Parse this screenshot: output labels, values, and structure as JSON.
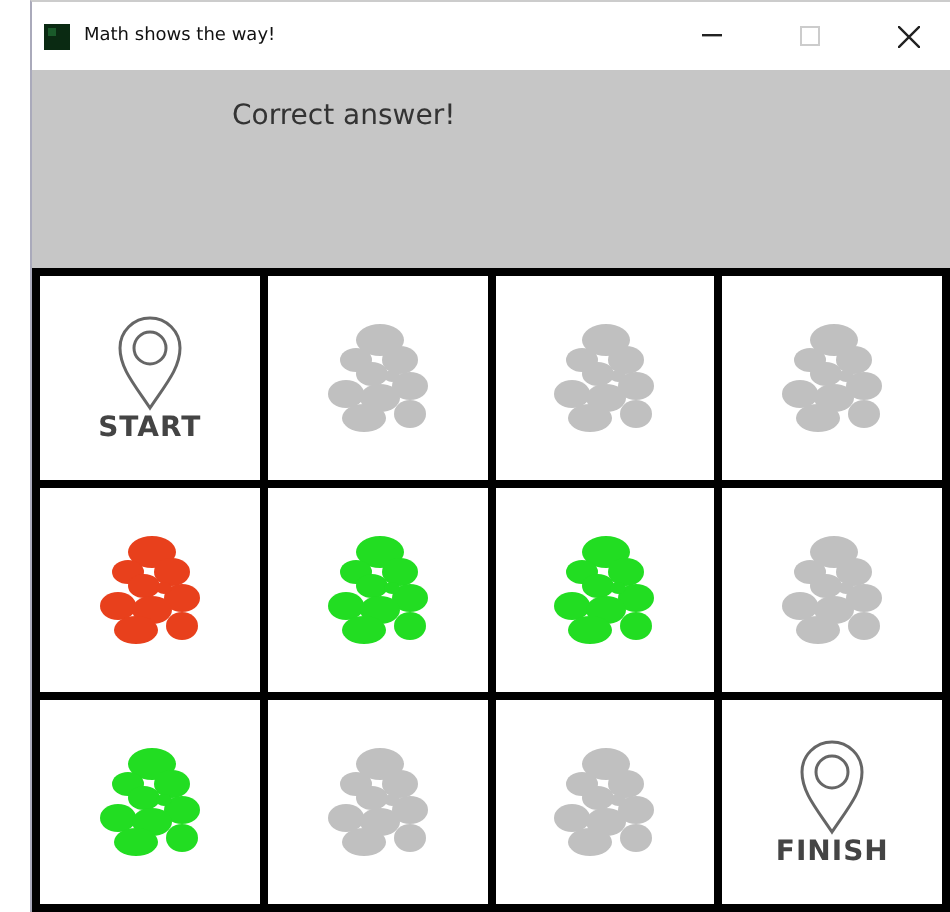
{
  "window": {
    "title": "Math shows the way!"
  },
  "message": "Correct answer!",
  "grid": [
    [
      {
        "kind": "marker",
        "label": "START"
      },
      {
        "kind": "stones",
        "color": "#c0c0c0"
      },
      {
        "kind": "stones",
        "color": "#c0c0c0"
      },
      {
        "kind": "stones",
        "color": "#c0c0c0"
      }
    ],
    [
      {
        "kind": "stones",
        "color": "#e8401c"
      },
      {
        "kind": "stones",
        "color": "#22dd22"
      },
      {
        "kind": "stones",
        "color": "#22dd22"
      },
      {
        "kind": "stones",
        "color": "#c0c0c0"
      }
    ],
    [
      {
        "kind": "stones",
        "color": "#22dd22"
      },
      {
        "kind": "stones",
        "color": "#c0c0c0"
      },
      {
        "kind": "stones",
        "color": "#c0c0c0"
      },
      {
        "kind": "marker",
        "label": "FINISH"
      }
    ]
  ]
}
